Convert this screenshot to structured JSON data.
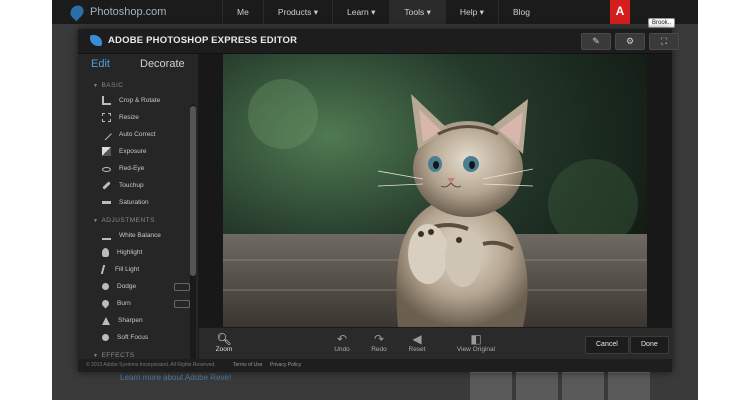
{
  "site": {
    "brand": "Photoshop.com",
    "nav": [
      "Me",
      "Products ▾",
      "Learn ▾",
      "Tools ▾",
      "Help ▾",
      "Blog"
    ],
    "adobe_badge": "A",
    "tooltip": "Brook..",
    "bg_link": "Learn more about Adobe Reve!"
  },
  "editor": {
    "title": "ADOBE PHOTOSHOP EXPRESS EDITOR",
    "toolbar_icons": [
      "tools-icon",
      "gear-icon",
      "fullscreen-icon"
    ],
    "tabs": {
      "edit": "Edit",
      "decorate": "Decorate"
    },
    "sections": [
      {
        "label": "BASIC",
        "items": [
          {
            "label": "Crop & Rotate",
            "icon": "crop-icon"
          },
          {
            "label": "Resize",
            "icon": "resize-icon"
          },
          {
            "label": "Auto Correct",
            "icon": "wand-icon"
          },
          {
            "label": "Exposure",
            "icon": "exposure-icon"
          },
          {
            "label": "Red-Eye",
            "icon": "eye-icon"
          },
          {
            "label": "Touchup",
            "icon": "touchup-icon"
          },
          {
            "label": "Saturation",
            "icon": "saturation-icon"
          }
        ]
      },
      {
        "label": "ADJUSTMENTS",
        "items": [
          {
            "label": "White Balance",
            "icon": "balance-icon"
          },
          {
            "label": "Highlight",
            "icon": "bulb-icon"
          },
          {
            "label": "Fill Light",
            "icon": "bolt-icon"
          },
          {
            "label": "Dodge",
            "icon": "dodge-icon"
          },
          {
            "label": "Burn",
            "icon": "burn-icon"
          },
          {
            "label": "Sharpen",
            "icon": "sharpen-icon"
          },
          {
            "label": "Soft Focus",
            "icon": "soft-focus-icon"
          }
        ]
      },
      {
        "label": "EFFECTS",
        "items": []
      }
    ],
    "bottom": {
      "zoom": "Zoom",
      "undo": "Undo",
      "redo": "Redo",
      "reset": "Reset",
      "view_original": "View Original",
      "cancel": "Cancel",
      "done": "Done"
    },
    "footer": {
      "copyright": "© 2013 Adobe Systems Incorporated. All Rights Reserved.",
      "terms": "Terms of Use",
      "privacy": "Privacy Policy"
    }
  },
  "colors": {
    "accent": "#4f9fe0",
    "adobe_red": "#d61d1d",
    "panel": "#262626"
  }
}
